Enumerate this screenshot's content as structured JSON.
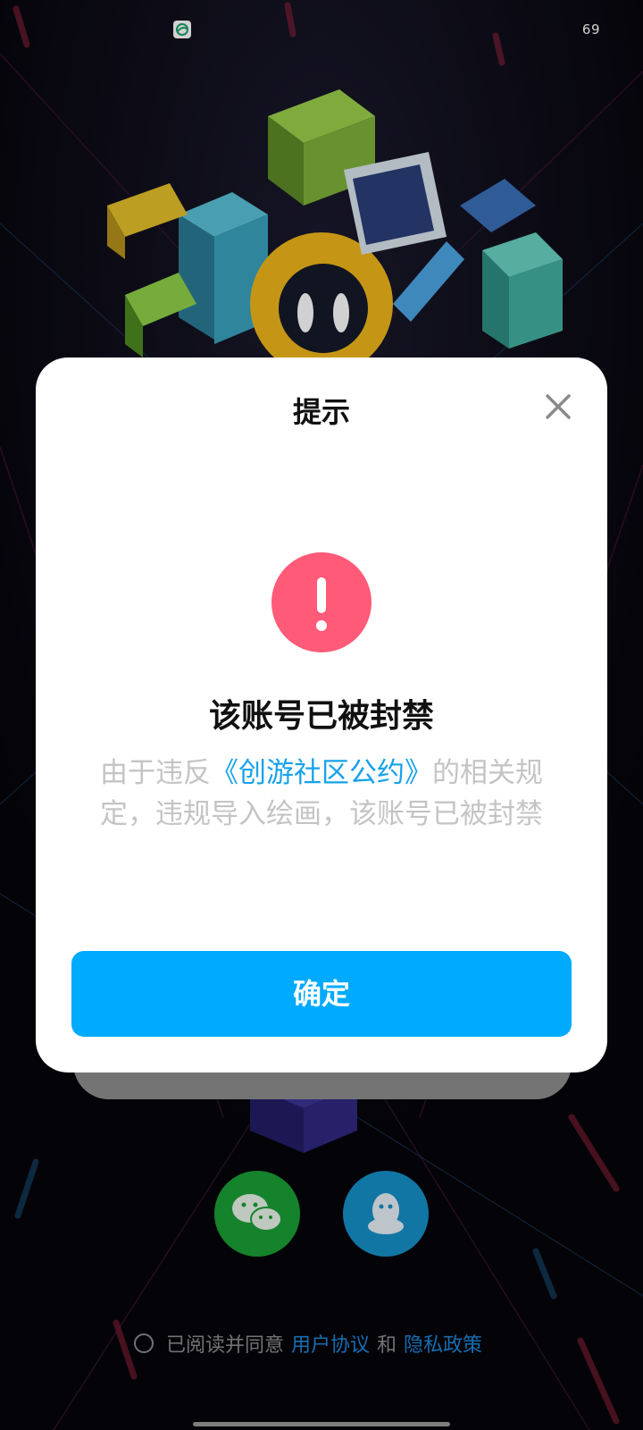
{
  "status_bar": {
    "battery": "69",
    "carrier_icon": "china-mobile-icon"
  },
  "dialog": {
    "title": "提示",
    "close_icon": "close-icon",
    "alert_icon": "exclamation-icon",
    "heading": "该账号已被封禁",
    "message_before_link": "由于违反",
    "message_link": "《创游社区公约》",
    "message_after_link": "的相关规定，违规导入绘画，该账号已被封禁",
    "confirm_label": "确定"
  },
  "login": {
    "wechat_icon": "wechat-icon",
    "qq_icon": "qq-icon"
  },
  "agreement": {
    "prefix": "已阅读并同意",
    "user_agreement": "用户协议",
    "conjunction": "和",
    "privacy_policy": "隐私政策"
  },
  "colors": {
    "accent": "#00aaff",
    "alert": "#ff5a78",
    "link": "#16a2ea",
    "wechat": "#1aa035",
    "qq": "#1790c8"
  }
}
